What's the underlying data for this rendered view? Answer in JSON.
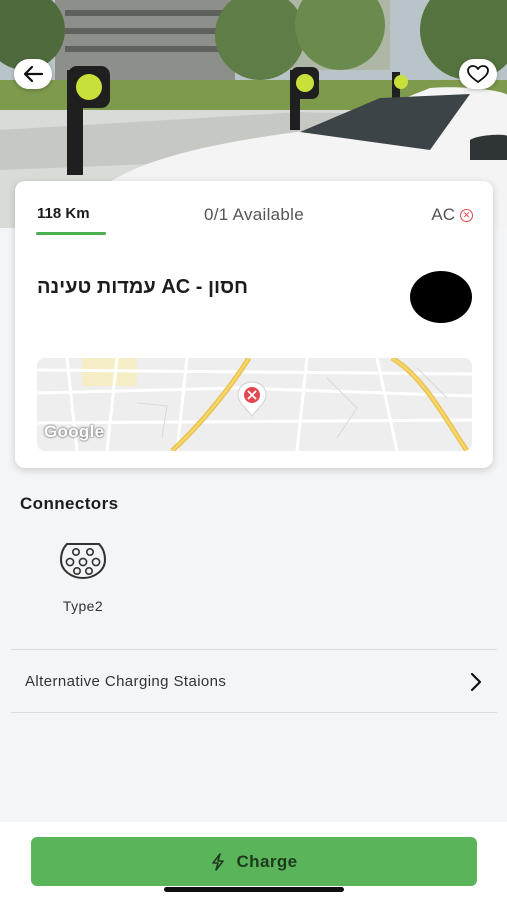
{
  "header": {
    "back_icon": "arrow-left-icon",
    "favorite_icon": "heart-icon"
  },
  "station": {
    "distance": "118 Km",
    "availability": "0/1 Available",
    "current_type": "AC",
    "status_icon": "close-circle-icon",
    "name": "חסון - AC עמדות טעינה",
    "map_watermark": "Google",
    "colors": {
      "accent_green": "#4cb050",
      "status_red": "#e4474f"
    }
  },
  "connectors": {
    "title": "Connectors",
    "items": [
      {
        "icon": "type2-plug-icon",
        "label": "Type2"
      }
    ]
  },
  "alternatives": {
    "label": "Alternative Charging Staions",
    "icon": "chevron-right-icon"
  },
  "action": {
    "charge_label": "Charge",
    "charge_icon": "lightning-icon",
    "button_color": "#5ab55a"
  }
}
